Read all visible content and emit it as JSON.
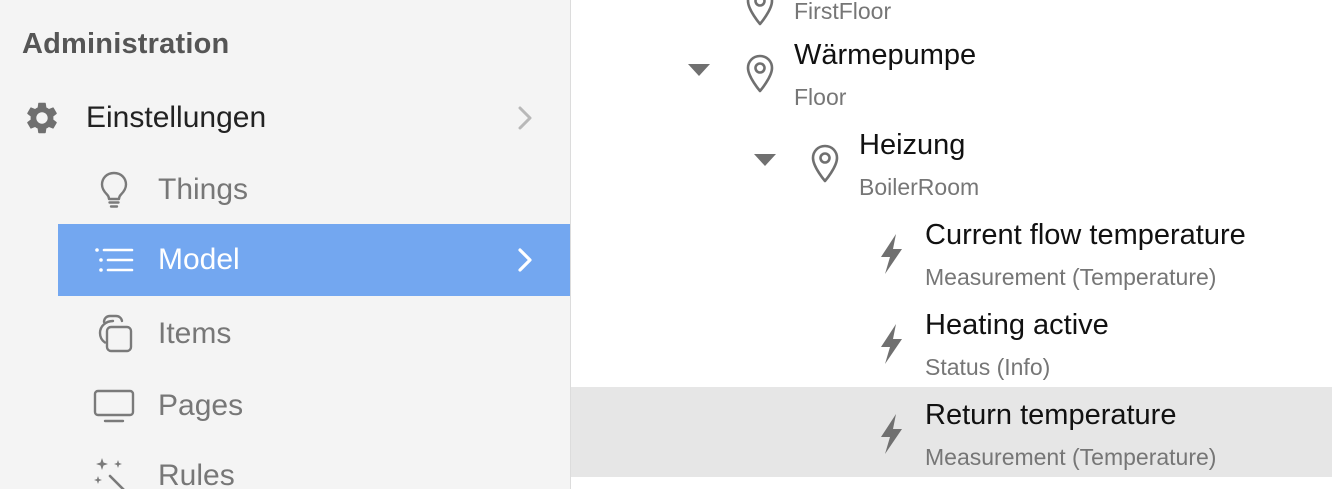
{
  "sidebar": {
    "title": "Administration",
    "settings": {
      "label": "Einstellungen",
      "icon": "gear-icon"
    },
    "items": [
      {
        "label": "Things",
        "icon": "lightbulb-icon"
      },
      {
        "label": "Model",
        "icon": "list-icon",
        "active": true
      },
      {
        "label": "Items",
        "icon": "stacked-squares-icon"
      },
      {
        "label": "Pages",
        "icon": "monitor-icon"
      },
      {
        "label": "Rules",
        "icon": "magic-wand-icon"
      }
    ],
    "active_color": "#73a7f0"
  },
  "tree": {
    "nodes": [
      {
        "title": "",
        "subtitle": "FirstFloor",
        "icon": "location-pin-icon"
      },
      {
        "title": "Wärmepumpe",
        "subtitle": "Floor",
        "icon": "location-pin-icon",
        "expanded": true
      },
      {
        "title": "Heizung",
        "subtitle": "BoilerRoom",
        "icon": "location-pin-icon",
        "expanded": true
      },
      {
        "title": "Current flow temperature",
        "subtitle": "Measurement (Temperature)",
        "icon": "lightning-bolt-icon"
      },
      {
        "title": "Heating active",
        "subtitle": "Status (Info)",
        "icon": "lightning-bolt-icon"
      },
      {
        "title": "Return temperature",
        "subtitle": "Measurement (Temperature)",
        "icon": "lightning-bolt-icon",
        "selected": true
      }
    ],
    "selected_color": "#e6e6e6"
  }
}
